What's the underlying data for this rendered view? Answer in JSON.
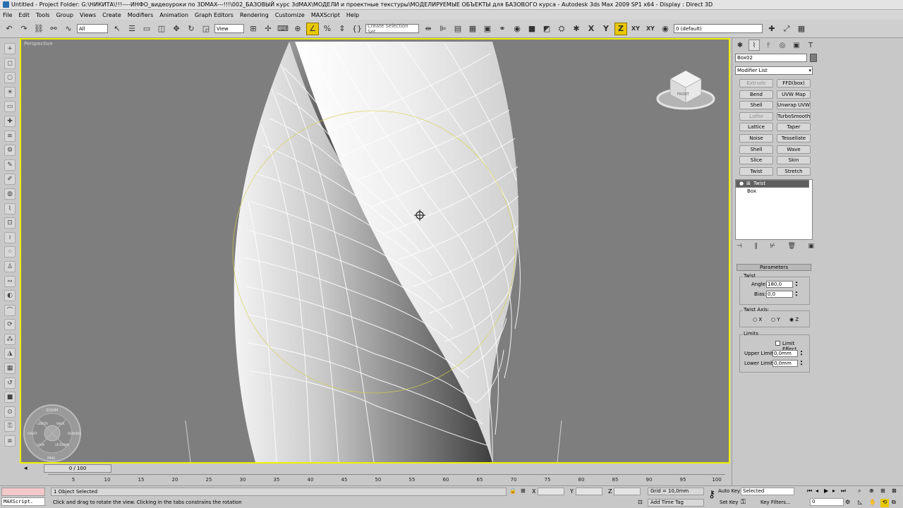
{
  "window": {
    "title": "Untitled      - Project Folder: G:\\НИКИТА\\!!!----ИНФО_видеоуроки по 3DMAX---!!!\\002_БАЗОВЫЙ курс 3dMAX\\МОДЕЛИ и проектные текстуры\\МОДЕЛИРУЕМЫЕ ОБЪЕКТЫ для БАЗОВОГО курса    - Autodesk 3ds Max  2009 SP1  x64        - Display : Direct 3D"
  },
  "menu": {
    "items": [
      "File",
      "Edit",
      "Tools",
      "Group",
      "Views",
      "Create",
      "Modifiers",
      "Animation",
      "Graph Editors",
      "Rendering",
      "Customize",
      "MAXScript",
      "Help"
    ]
  },
  "toolbar": {
    "filter_value": "All",
    "refcoord_value": "View",
    "selection_set_placeholder": "Create Selection Set",
    "axis_x": "X",
    "axis_y": "Y",
    "axis_z": "Z",
    "axis_xy": "XY",
    "axis_xy2": "XY",
    "layer_value": "0 (default)"
  },
  "viewport": {
    "label": "Perspective",
    "viewcube_label": "FRONT",
    "steering_wheel": {
      "zoom": "ZOOM",
      "orbit": "ORBIT",
      "center": "CENTER",
      "walk": "WALK",
      "rewind": "REWIND",
      "look": "LOOK",
      "up_down": "UP/DOWN",
      "pan": "PAN"
    }
  },
  "timeline": {
    "frame_counter": "0 / 100",
    "ticks": [
      "5",
      "10",
      "15",
      "20",
      "25",
      "30",
      "35",
      "40",
      "45",
      "50",
      "55",
      "60",
      "65",
      "70",
      "75",
      "80",
      "85",
      "90",
      "95",
      "100"
    ]
  },
  "statusbar": {
    "maxscript_label": "MAXScript.",
    "selection_status": "1 Object Selected",
    "prompt": "Click and drag to rotate the view.  Clicking in the tabs constrains the rotation",
    "x_label": "X",
    "y_label": "Y",
    "z_label": "Z",
    "grid": "Grid = 10,0mm",
    "add_time_tag": "Add Time Tag",
    "auto_key": "Auto Key",
    "set_key": "Set Key",
    "auto_key_value": "Selected",
    "key_filters": "Key Filters...",
    "current_frame": "0"
  },
  "command_panel": {
    "object_name": "Box02",
    "object_color": "#7d7d7d",
    "modifier_list": "Modifier List",
    "modifier_buttons": [
      {
        "label": "Extrude",
        "enabled": false
      },
      {
        "label": "FFD(box)",
        "enabled": true
      },
      {
        "label": "Bend",
        "enabled": true
      },
      {
        "label": "UVW Map",
        "enabled": true
      },
      {
        "label": "Shell",
        "enabled": true
      },
      {
        "label": "Unwrap UVW",
        "enabled": true
      },
      {
        "label": "Lathe",
        "enabled": false
      },
      {
        "label": "TurboSmooth",
        "enabled": true
      },
      {
        "label": "Lattice",
        "enabled": true
      },
      {
        "label": "Taper",
        "enabled": true
      },
      {
        "label": "Noise",
        "enabled": true
      },
      {
        "label": "Tessellate",
        "enabled": true
      },
      {
        "label": "Shell",
        "enabled": true
      },
      {
        "label": "Wave",
        "enabled": true
      },
      {
        "label": "Slice",
        "enabled": true
      },
      {
        "label": "Skin",
        "enabled": true
      },
      {
        "label": "Twist",
        "enabled": true
      },
      {
        "label": "Stretch",
        "enabled": true
      }
    ],
    "stack": [
      {
        "label": "Twist",
        "selected": true
      },
      {
        "label": "Box",
        "selected": false
      }
    ],
    "parameters": {
      "rollout_title": "Parameters",
      "twist_group": "Twist",
      "angle_label": "Angle:",
      "angle_value": "180,0",
      "bias_label": "Bias:",
      "bias_value": "0,0",
      "axis_group": "Twist Axis:",
      "axis_options": [
        "X",
        "Y",
        "Z"
      ],
      "axis_selected": "Z",
      "limits_group": "Limits",
      "limit_effect": "Limit Effect",
      "upper_label": "Upper Limit:",
      "upper_value": "0,0mm",
      "lower_label": "Lower Limit:",
      "lower_value": "0,0mm"
    }
  },
  "colors": {
    "viewport_bg": "#7e7e7e",
    "active_border": "#f0f000",
    "active_tool": "#e8c800"
  }
}
